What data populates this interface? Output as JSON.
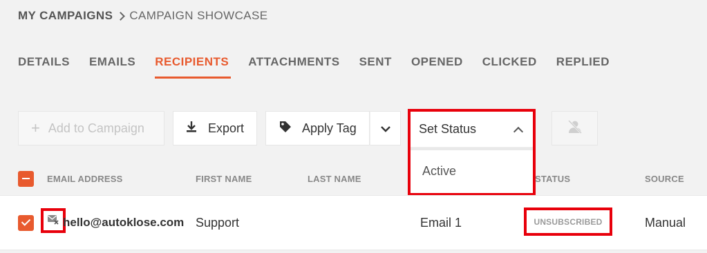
{
  "breadcrumb": {
    "root": "MY CAMPAIGNS",
    "current": "CAMPAIGN SHOWCASE"
  },
  "tabs": [
    {
      "label": "DETAILS",
      "active": false
    },
    {
      "label": "EMAILS",
      "active": false
    },
    {
      "label": "RECIPIENTS",
      "active": true
    },
    {
      "label": "ATTACHMENTS",
      "active": false
    },
    {
      "label": "SENT",
      "active": false
    },
    {
      "label": "OPENED",
      "active": false
    },
    {
      "label": "CLICKED",
      "active": false
    },
    {
      "label": "REPLIED",
      "active": false
    }
  ],
  "toolbar": {
    "add_label": "Add to Campaign",
    "export_label": "Export",
    "apply_tag_label": "Apply Tag",
    "set_status_label": "Set Status",
    "status_options": [
      "Active"
    ]
  },
  "table": {
    "headers": {
      "email": "EMAIL ADDRESS",
      "first_name": "FIRST NAME",
      "last_name": "LAST NAME",
      "status": "STATUS",
      "source": "SOURCE"
    },
    "rows": [
      {
        "email": "hello@autoklose.com",
        "first_name": "Support",
        "last_name": "",
        "email_step": "Email 1",
        "status": "UNSUBSCRIBED",
        "source": "Manual"
      }
    ]
  },
  "colors": {
    "accent": "#e85a2e",
    "highlight": "#e8000b"
  }
}
